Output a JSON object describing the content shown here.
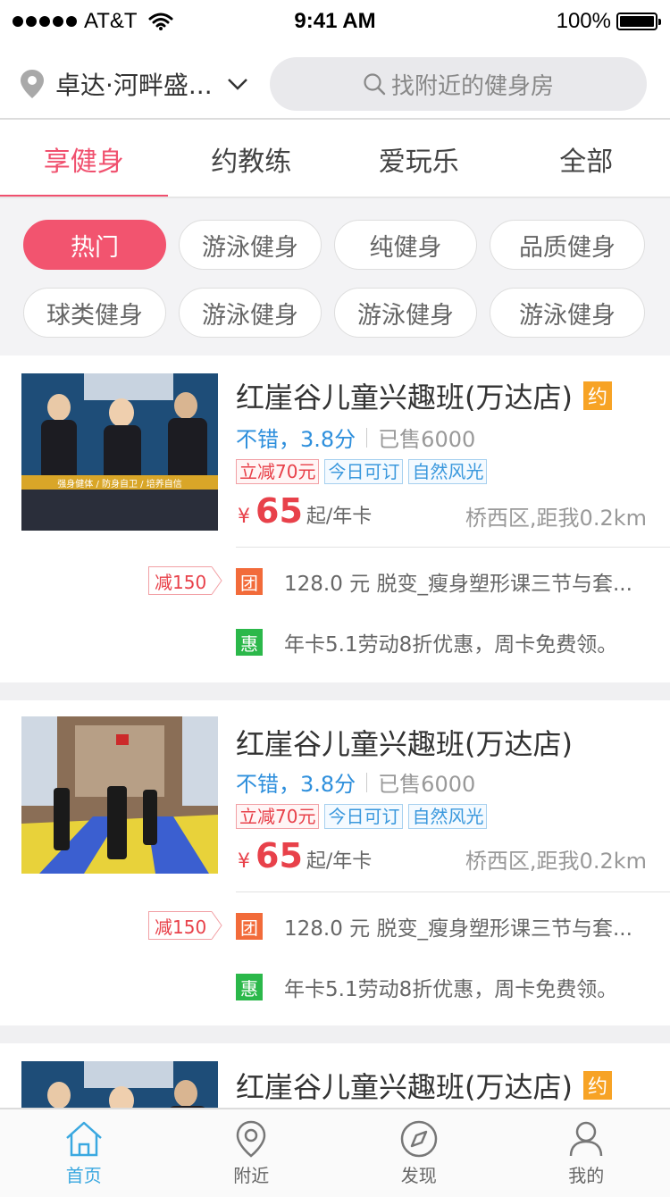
{
  "status_bar": {
    "carrier": "AT&T",
    "time": "9:41 AM",
    "battery": "100%"
  },
  "header": {
    "location": "卓达·河畔盛...",
    "search_placeholder": "找附近的健身房"
  },
  "tabs": [
    {
      "label": "享健身",
      "active": true
    },
    {
      "label": "约教练",
      "active": false
    },
    {
      "label": "爱玩乐",
      "active": false
    },
    {
      "label": "全部",
      "active": false
    }
  ],
  "filters": {
    "row1": [
      "热门",
      "游泳健身",
      "纯健身",
      "品质健身"
    ],
    "row2": [
      "球类健身",
      "游泳健身",
      "游泳健身",
      "游泳健身"
    ]
  },
  "cards": [
    {
      "title": "红崖谷儿童兴趣班(万达店)",
      "badge": "约",
      "rating": "不错，3.8分",
      "sold": "已售6000",
      "tags": [
        "立减70元",
        "今日可订",
        "自然风光"
      ],
      "currency": "¥",
      "price": "65",
      "unit": "起/年卡",
      "distance": "桥西区,距我0.2km",
      "discount": "减150",
      "promos": [
        {
          "icon": "团",
          "text": "128.0 元 脱变_瘦身塑形课三节与套..."
        },
        {
          "icon": "惠",
          "text": "年卡5.1劳动8折优惠，周卡免费领。"
        }
      ],
      "image_caption": "强身健体 / 防身自卫 / 培养自信"
    },
    {
      "title": "红崖谷儿童兴趣班(万达店)",
      "rating": "不错，3.8分",
      "sold": "已售6000",
      "tags": [
        "立减70元",
        "今日可订",
        "自然风光"
      ],
      "currency": "¥",
      "price": "65",
      "unit": "起/年卡",
      "distance": "桥西区,距我0.2km",
      "discount": "减150",
      "promos": [
        {
          "icon": "团",
          "text": "128.0 元 脱变_瘦身塑形课三节与套..."
        },
        {
          "icon": "惠",
          "text": "年卡5.1劳动8折优惠，周卡免费领。"
        }
      ]
    },
    {
      "title": "红崖谷儿童兴趣班(万达店)",
      "badge": "约"
    }
  ],
  "bottom_nav": [
    {
      "label": "首页",
      "icon": "home-icon",
      "active": true
    },
    {
      "label": "附近",
      "icon": "location-pin-icon",
      "active": false
    },
    {
      "label": "发现",
      "icon": "compass-icon",
      "active": false
    },
    {
      "label": "我的",
      "icon": "user-icon",
      "active": false
    }
  ],
  "colors": {
    "accent": "#f0506e",
    "price": "#e8414a",
    "link": "#2e8fdc",
    "nav_active": "#3aa8e0"
  }
}
